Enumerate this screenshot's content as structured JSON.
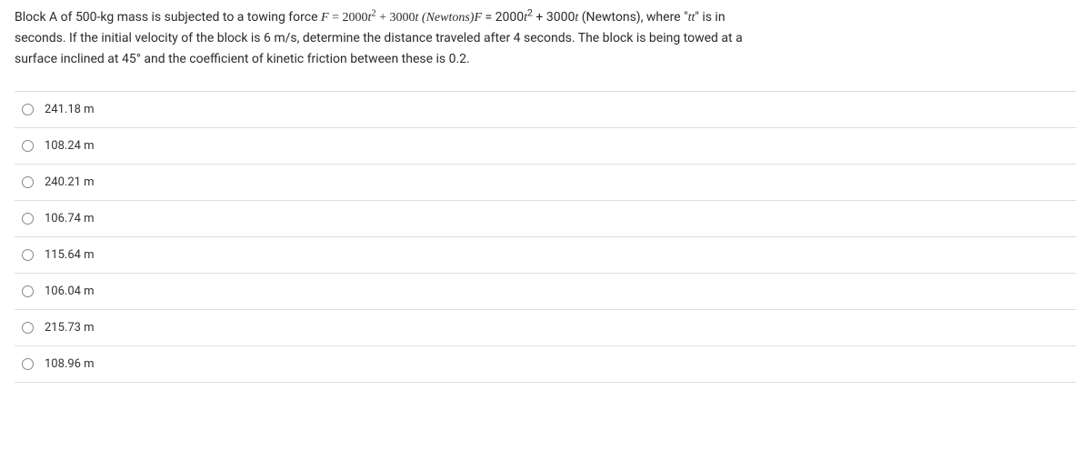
{
  "question": {
    "line1_part1": "Block A of 500-kg mass is subjected to a towing force ",
    "formula_serif_F": "F",
    "formula_equals": " = ",
    "formula_part1": "2000",
    "formula_t": "t",
    "formula_sup2": "2",
    "formula_plus": " + ",
    "formula_part2": "3000",
    "formula_newtons_serif": " (Newtons)",
    "formula_repeat_F": "F",
    "formula_repeat_eq": " = ",
    "formula_repeat_1": "2000",
    "formula_repeat_t": "t",
    "formula_repeat_sup": "2",
    "formula_repeat_plus": " + ",
    "formula_repeat_2": "3000",
    "formula_repeat_t2": "t",
    "formula_repeat_newtons": " (Newtons)",
    "line1_part2": ", where \"",
    "line1_tt": "tt",
    "line1_part3": "\" is in",
    "line2": "seconds. If the initial velocity of the block is 6 m/s, determine the distance traveled after 4 seconds. The block is being towed at a",
    "line3": "surface inclined at 45° and the coefficient of kinetic friction between these is 0.2."
  },
  "options": [
    {
      "label": "241.18 m"
    },
    {
      "label": "108.24 m"
    },
    {
      "label": "240.21 m"
    },
    {
      "label": "106.74 m"
    },
    {
      "label": "115.64 m"
    },
    {
      "label": "106.04 m"
    },
    {
      "label": "215.73 m"
    },
    {
      "label": "108.96 m"
    }
  ]
}
